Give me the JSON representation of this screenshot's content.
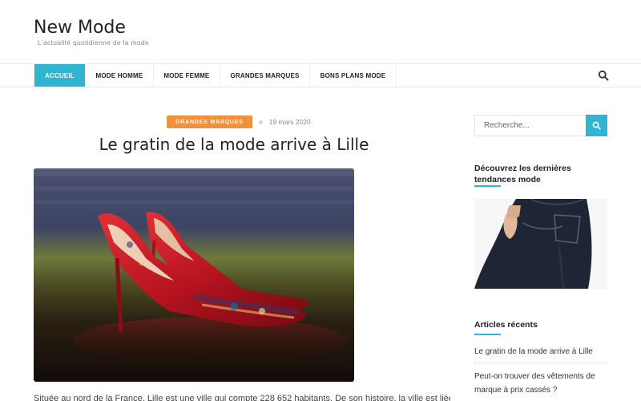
{
  "site": {
    "title": "New Mode",
    "tagline": "L'actualité quotidienne de la mode"
  },
  "nav": {
    "items": [
      {
        "label": "ACCUEIL",
        "active": true
      },
      {
        "label": "MODE HOMME",
        "active": false
      },
      {
        "label": "MODE FEMME",
        "active": false
      },
      {
        "label": "GRANDES MARQUES",
        "active": false
      },
      {
        "label": "BONS PLANS MODE",
        "active": false
      }
    ],
    "search_icon": "search-icon"
  },
  "post": {
    "category": "GRANDES MARQUES",
    "date": "19 mars 2020",
    "title": "Le gratin de la mode arrive à Lille",
    "excerpt": "Située au nord de la France, Lille est une ville qui compte 228 652 habitants. De son histoire, la ville est liée à la"
  },
  "sidebar": {
    "search_placeholder": "Recherche...",
    "search_icon": "search-icon",
    "promo_title": "Découvrez les dernières tendances mode",
    "recent_title": "Articles récents",
    "recent_posts": [
      "Le gratin de la mode arrive à Lille",
      "Peut-on trouver des vêtements de marque à prix cassés ?"
    ]
  },
  "colors": {
    "accent": "#2fb5d2",
    "category_badge": "#f0913e"
  }
}
